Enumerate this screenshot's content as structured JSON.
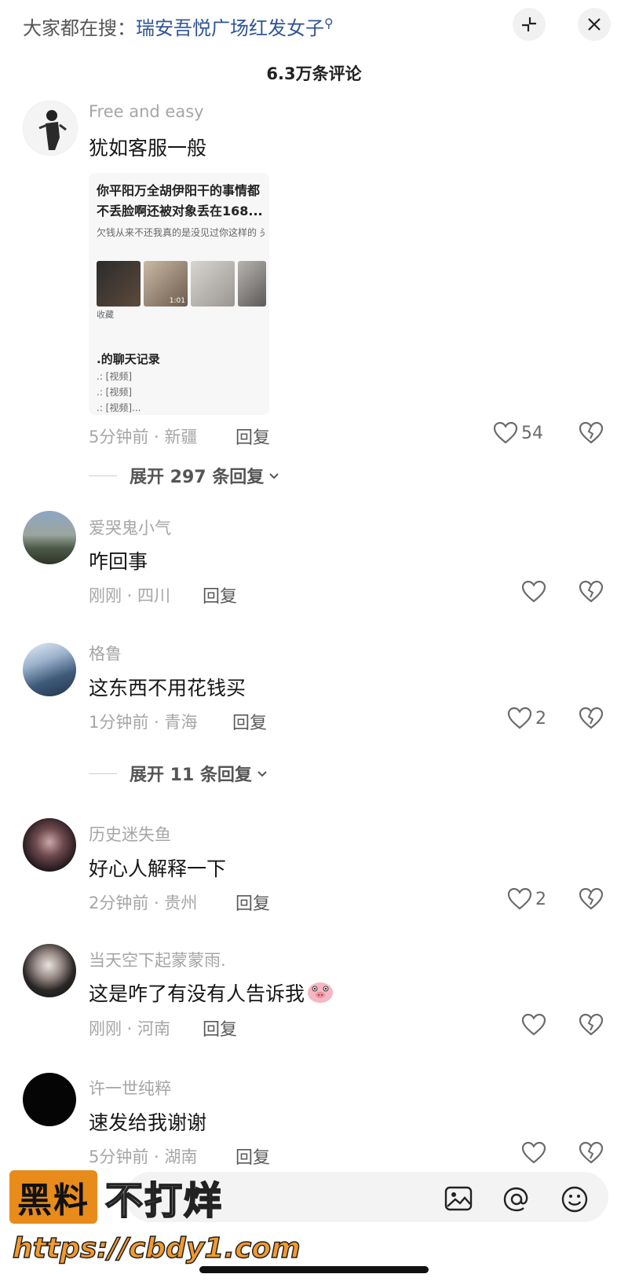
{
  "header": {
    "search_prefix": "大家都在搜：",
    "search_keyword": "瑞安吾悦广场红发女子",
    "comment_count": "6.3万条评论"
  },
  "comments": [
    {
      "username": "Free and easy",
      "text": "犹如客服一般",
      "meta": "5分钟前 · 新疆",
      "reply": "回复",
      "likes": "54",
      "expand": "展开 297 条回复",
      "attachment": {
        "title": "你平阳万全胡伊阳干的事情都不丢脸啊还被对象丢在168...",
        "preview": "欠钱从来不还我真的是没见过你这样的 头发染得跟个火龙果一样 大妈,...",
        "duration": "1:01",
        "fav_label": "收藏",
        "chat_title": ".的聊天记录",
        "lines": [
          ".: [视频]",
          ".: [视频]",
          ".: [视频]..."
        ]
      }
    },
    {
      "username": "爱哭鬼小气",
      "text": "咋回事",
      "meta": "刚刚 · 四川",
      "reply": "回复",
      "likes": ""
    },
    {
      "username": "格鲁",
      "text": "这东西不用花钱买",
      "meta": "1分钟前 · 青海",
      "reply": "回复",
      "likes": "2",
      "expand": "展开 11 条回复"
    },
    {
      "username": "历史迷失鱼",
      "text": "好心人解释一下",
      "meta": "2分钟前 · 贵州",
      "reply": "回复",
      "likes": "2"
    },
    {
      "username": "当天空下起蒙蒙雨.",
      "text": "这是咋了有没有人告诉我",
      "meta": "刚刚 · 河南",
      "reply": "回复",
      "likes": ""
    },
    {
      "username": "许一世纯粹",
      "text": "速发给我谢谢",
      "meta": "5分钟前 · 湖南",
      "reply": "回复",
      "likes": ""
    }
  ],
  "watermark": {
    "box_text": "黑料",
    "text": "不打烊",
    "url": "https://cbdy1.com"
  }
}
